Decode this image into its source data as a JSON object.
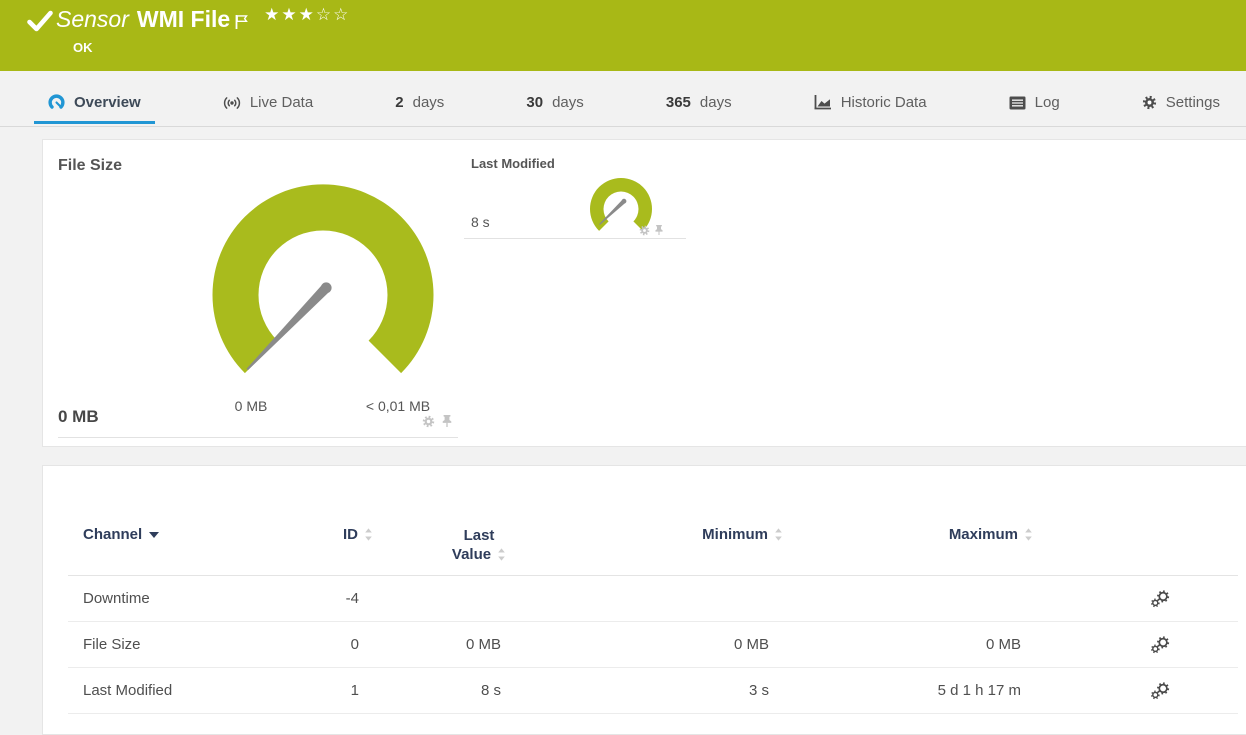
{
  "colors": {
    "header_green": "#a8b816",
    "gauge_green": "#a9bb1d",
    "accent_blue": "#2196d4",
    "needle_gray": "#8a8a8a"
  },
  "header": {
    "kind_label": "Sensor",
    "title": "WMI File",
    "status": "OK",
    "stars_filled": "★★★",
    "stars_empty": "☆☆",
    "rating": "3 of 5"
  },
  "tabs": [
    {
      "label": "Overview",
      "icon": "gauge-icon",
      "active": true
    },
    {
      "label": "Live Data",
      "icon": "live-icon"
    },
    {
      "prefix": "2",
      "label": "days"
    },
    {
      "prefix": "30",
      "label": "days"
    },
    {
      "prefix": "365",
      "label": "days"
    },
    {
      "label": "Historic Data",
      "icon": "area-chart-icon"
    },
    {
      "label": "Log",
      "icon": "log-icon"
    },
    {
      "label": "Settings",
      "icon": "gear-icon"
    }
  ],
  "gauges": {
    "primary": {
      "title": "File Size",
      "value": "0 MB",
      "min_label": "0 MB",
      "max_label": "< 0,01 MB"
    },
    "secondary": {
      "title": "Last Modified",
      "value": "8 s"
    }
  },
  "channel_table": {
    "header": {
      "channel": "Channel",
      "id": "ID",
      "last": "Last Value",
      "min": "Minimum",
      "max": "Maximum"
    },
    "rows": [
      {
        "channel": "Downtime",
        "id": "-4",
        "last": "",
        "min": "",
        "max": ""
      },
      {
        "channel": "File Size",
        "id": "0",
        "last": "0 MB",
        "min": "0 MB",
        "max": "0 MB"
      },
      {
        "channel": "Last Modified",
        "id": "1",
        "last": "8 s",
        "min": "3 s",
        "max": "5 d 1 h 17 m"
      }
    ]
  }
}
